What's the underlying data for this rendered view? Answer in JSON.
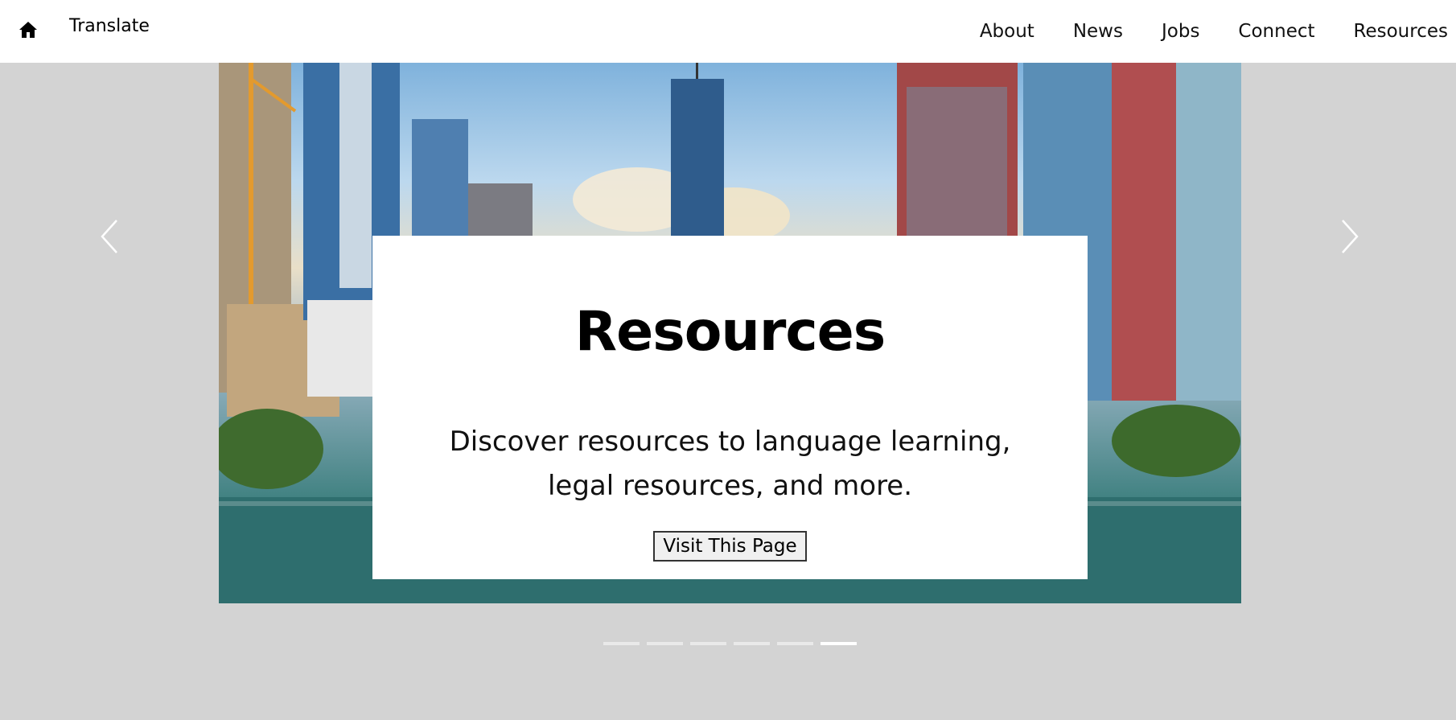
{
  "header": {
    "home_icon": "home-icon",
    "translate_label": "Translate",
    "nav": [
      {
        "label": "About"
      },
      {
        "label": "News"
      },
      {
        "label": "Jobs"
      },
      {
        "label": "Connect"
      },
      {
        "label": "Resources"
      }
    ]
  },
  "carousel": {
    "prev_icon": "chevron-left-icon",
    "next_icon": "chevron-right-icon",
    "slide": {
      "title": "Resources",
      "description": "Discover resources to language learning, legal resources, and more.",
      "button_label": "Visit This Page",
      "image": "city-skyline-river-photo"
    },
    "indicator_count": 6,
    "active_indicator": 6
  },
  "colors": {
    "page_background": "#d3d3d3",
    "header_background": "#ffffff",
    "card_background": "#ffffff"
  }
}
